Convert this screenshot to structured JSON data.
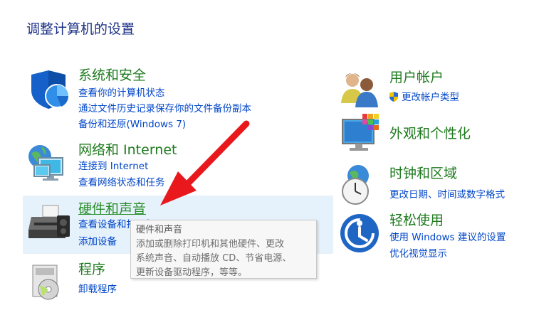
{
  "page_title": "调整计算机的设置",
  "categories": {
    "system": {
      "heading": "系统和安全",
      "links": [
        "查看你的计算机状态",
        "通过文件历史记录保存你的文件备份副本",
        "备份和还原(Windows 7)"
      ]
    },
    "network": {
      "heading": "网络和 Internet",
      "links": [
        "连接到 Internet",
        "查看网络状态和任务"
      ]
    },
    "hardware": {
      "heading": "硬件和声音",
      "links": [
        "查看设备和打印机",
        "添加设备"
      ]
    },
    "programs": {
      "heading": "程序",
      "links": [
        "卸载程序"
      ]
    },
    "accounts": {
      "heading": "用户帐户",
      "links": [
        "更改帐户类型"
      ]
    },
    "appearance": {
      "heading": "外观和个性化",
      "links": []
    },
    "clock": {
      "heading": "时钟和区域",
      "links": [
        "更改日期、时间或数字格式"
      ]
    },
    "ease": {
      "heading": "轻松使用",
      "links": [
        "使用 Windows 建议的设置",
        "优化视觉显示"
      ]
    }
  },
  "tooltip": {
    "title": "硬件和声音",
    "line1": "添加或删除打印机和其他硬件、更改",
    "line2": "系统声音、自动播放 CD、节省电源、",
    "line3": "更新设备驱动程序，等等。"
  },
  "colors": {
    "heading_green": "#1e7a1e",
    "link_blue": "#0046c8",
    "title_blue": "#1e3287",
    "hover_bg": "#e5f1fb",
    "arrow_red": "#e8181c"
  }
}
